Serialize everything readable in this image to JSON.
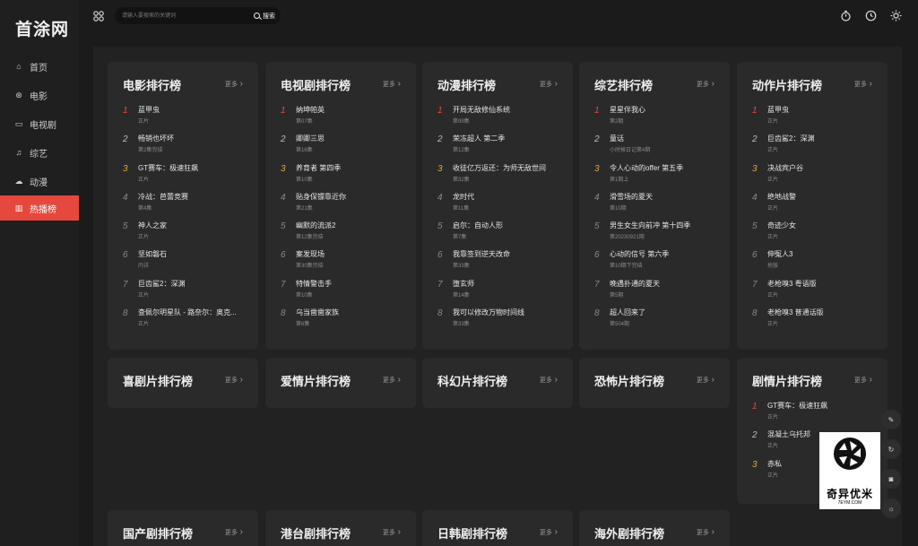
{
  "app": {
    "logo": "首涂网"
  },
  "sidebar": {
    "items": [
      {
        "label": "首页",
        "icon": "home-icon",
        "glyph": "⌂"
      },
      {
        "label": "电影",
        "icon": "film-reel-icon",
        "glyph": "⊛"
      },
      {
        "label": "电视剧",
        "icon": "tv-icon",
        "glyph": "▭"
      },
      {
        "label": "综艺",
        "icon": "music-note-icon",
        "glyph": "♫"
      },
      {
        "label": "动漫",
        "icon": "anime-icon",
        "glyph": "☁"
      },
      {
        "label": "热播榜",
        "icon": "chart-icon",
        "glyph": "▥",
        "active": true
      }
    ]
  },
  "search": {
    "placeholder": "请输入要搜索的关键词",
    "button_label": "搜索"
  },
  "colors": {
    "accent": "#e5483c",
    "rank1": "#e5483c",
    "rank3": "#e8a33c",
    "card_bg": "#2a2a2a",
    "page_bg": "#1b1b1b"
  },
  "more_label": "更多",
  "cards": [
    {
      "title": "电影排行榜",
      "items": [
        {
          "title": "蓝甲虫",
          "sub": "正片"
        },
        {
          "title": "畅销也坏坏",
          "sub": "第2集完结"
        },
        {
          "title": "GT赛车：极速狂飙",
          "sub": "正片"
        },
        {
          "title": "冷战：芭蕾竞赛",
          "sub": "第4集"
        },
        {
          "title": "神人之家",
          "sub": "正片"
        },
        {
          "title": "坚如磐石",
          "sub": "内详"
        },
        {
          "title": "巨齿鲨2：深渊",
          "sub": "正片"
        },
        {
          "title": "查佩尔明星队 - 路奈尔：奥克...",
          "sub": "正片"
        }
      ]
    },
    {
      "title": "电视剧排行榜",
      "items": [
        {
          "title": "纳坤帕英",
          "sub": "第07集"
        },
        {
          "title": "卿卿三思",
          "sub": "第16集"
        },
        {
          "title": "养育者 第四季",
          "sub": "第10集"
        },
        {
          "title": "贴身保镖靠近你",
          "sub": "第21集"
        },
        {
          "title": "幽默的流派2",
          "sub": "第12集完结"
        },
        {
          "title": "案发现场",
          "sub": "第30集完结"
        },
        {
          "title": "特情警击手",
          "sub": "第10集"
        },
        {
          "title": "乌当凿凿家族",
          "sub": "第6集"
        }
      ]
    },
    {
      "title": "动漫排行榜",
      "items": [
        {
          "title": "开局无敌修仙系统",
          "sub": "第99集"
        },
        {
          "title": "荣冻超人 第二季",
          "sub": "第12集"
        },
        {
          "title": "收徒亿万返还：为师无敌世间",
          "sub": "第32集"
        },
        {
          "title": "龙时代",
          "sub": "第11集"
        },
        {
          "title": "启尔：自动人形",
          "sub": "第7集"
        },
        {
          "title": "我靠签到逆天改命",
          "sub": "第33集"
        },
        {
          "title": "堕玄师",
          "sub": "第14集"
        },
        {
          "title": "我可以修改万物时间线",
          "sub": "第33集"
        }
      ]
    },
    {
      "title": "综艺排行榜",
      "items": [
        {
          "title": "星星伴我心",
          "sub": "第2期"
        },
        {
          "title": "童话",
          "sub": "小时候日记第4期"
        },
        {
          "title": "令人心动的offer 第五季",
          "sub": "第1期上"
        },
        {
          "title": "滑雪场的夏天",
          "sub": "第10期"
        },
        {
          "title": "男生女生向前冲 第十四季",
          "sub": "第20230921期"
        },
        {
          "title": "心动的信号 第六季",
          "sub": "第10期下完结"
        },
        {
          "title": "晚遇扑通的夏天",
          "sub": "第5期"
        },
        {
          "title": "超人回来了",
          "sub": "第504期"
        }
      ]
    },
    {
      "title": "动作片排行榜",
      "items": [
        {
          "title": "蓝甲虫",
          "sub": "正片"
        },
        {
          "title": "巨齿鲨2：深渊",
          "sub": "正片"
        },
        {
          "title": "决战宾户谷",
          "sub": "正片"
        },
        {
          "title": "绝地战警",
          "sub": "正片"
        },
        {
          "title": "奇迹少女",
          "sub": "正片"
        },
        {
          "title": "伸冤人3",
          "sub": "抢版"
        },
        {
          "title": "老枪嗅3 粤语版",
          "sub": "正片"
        },
        {
          "title": "老枪嗅3 普通话版",
          "sub": "正片"
        }
      ]
    },
    {
      "title": "喜剧片排行榜",
      "items": []
    },
    {
      "title": "爱情片排行榜",
      "items": []
    },
    {
      "title": "科幻片排行榜",
      "items": []
    },
    {
      "title": "恐怖片排行榜",
      "items": []
    },
    {
      "title": "剧情片排行榜",
      "items": [
        {
          "title": "GT赛车：极速狂飙",
          "sub": "正片"
        },
        {
          "title": "混凝土乌托邦",
          "sub": "正片"
        },
        {
          "title": "赤私",
          "sub": "正片"
        }
      ]
    },
    {
      "title": "国产剧排行榜",
      "items": []
    },
    {
      "title": "港台剧排行榜",
      "items": []
    },
    {
      "title": "日韩剧排行榜",
      "items": []
    },
    {
      "title": "海外剧排行榜",
      "items": []
    }
  ],
  "float_tools": [
    {
      "icon": "edit-icon",
      "glyph": "✎"
    },
    {
      "icon": "refresh-icon",
      "glyph": "↻"
    },
    {
      "icon": "lock-icon",
      "glyph": "◙"
    },
    {
      "icon": "brightness-icon",
      "glyph": "☼"
    }
  ],
  "watermark": {
    "text": "奇异优米",
    "small": "7EYM.COM"
  }
}
